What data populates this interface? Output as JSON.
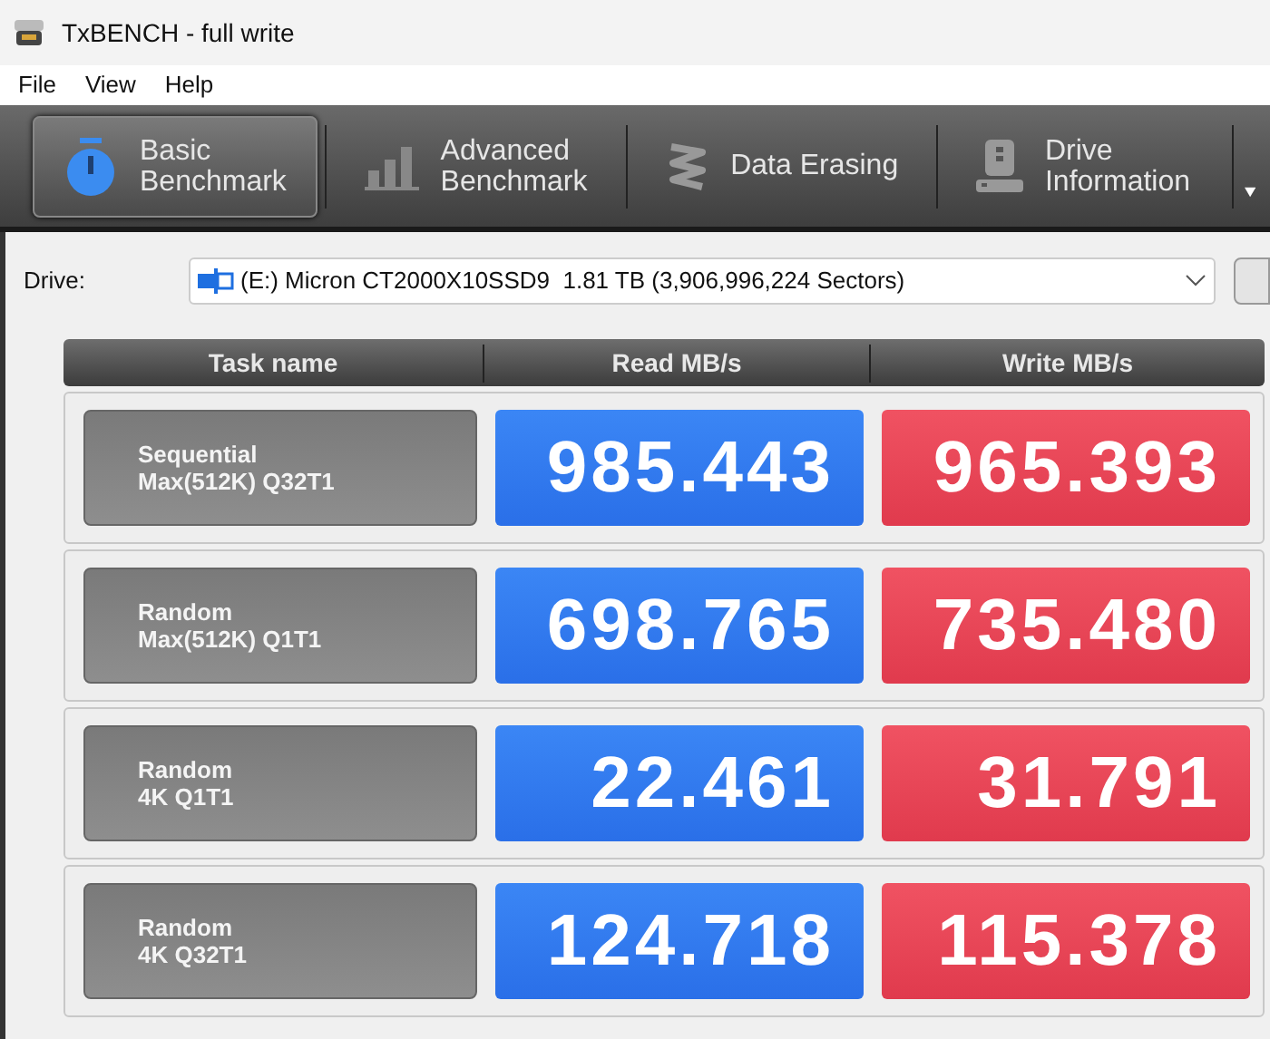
{
  "window": {
    "title": "TxBENCH - full write"
  },
  "menu": [
    "File",
    "View",
    "Help"
  ],
  "tabs": [
    {
      "kind": "timer",
      "lines": [
        "Basic",
        "Benchmark"
      ],
      "selected": true
    },
    {
      "kind": "bars",
      "lines": [
        "Advanced",
        "Benchmark"
      ],
      "selected": false
    },
    {
      "kind": "erase",
      "lines": [
        "Data Erasing"
      ],
      "selected": false
    },
    {
      "kind": "drive",
      "lines": [
        "Drive",
        "Information"
      ],
      "selected": false
    }
  ],
  "drive": {
    "label": "Drive:",
    "value": "(E:) Micron CT2000X10SSD9  1.81 TB (3,906,996,224 Sectors)"
  },
  "table": {
    "columns": [
      "Task name",
      "Read MB/s",
      "Write MB/s"
    ],
    "rows": [
      {
        "task": [
          "Sequential",
          "Max(512K) Q32T1"
        ],
        "read": "985.443",
        "write": "965.393"
      },
      {
        "task": [
          "Random",
          "Max(512K) Q1T1"
        ],
        "read": "698.765",
        "write": "735.480"
      },
      {
        "task": [
          "Random",
          "4K Q1T1"
        ],
        "read": "22.461",
        "write": "31.791"
      },
      {
        "task": [
          "Random",
          "4K Q32T1"
        ],
        "read": "124.718",
        "write": "115.378"
      }
    ]
  }
}
